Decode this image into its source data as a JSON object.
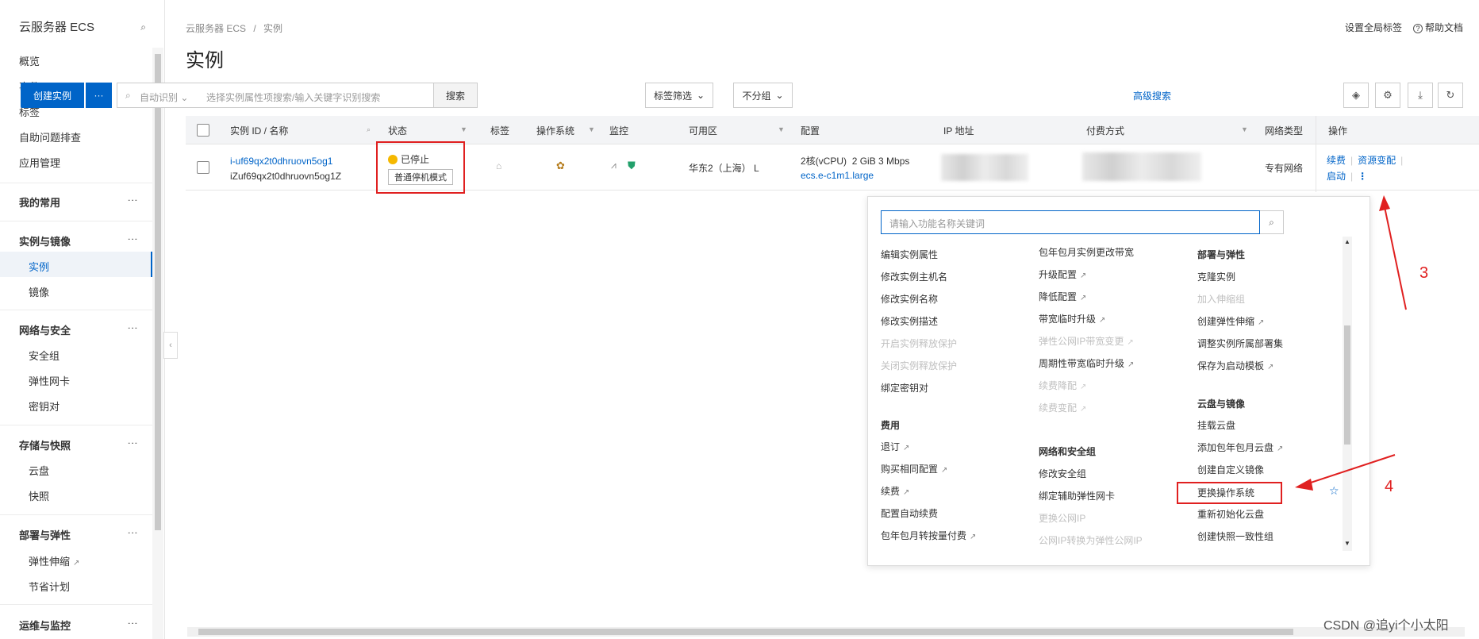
{
  "sidebar": {
    "title": "云服务器 ECS",
    "items": [
      "概览",
      "事件",
      "标签",
      "自助问题排查",
      "应用管理"
    ],
    "groups": [
      {
        "label": "我的常用"
      },
      {
        "label": "实例与镜像",
        "children": [
          "实例",
          "镜像"
        ]
      },
      {
        "label": "网络与安全",
        "children": [
          "安全组",
          "弹性网卡",
          "密钥对"
        ]
      },
      {
        "label": "存储与快照",
        "children": [
          "云盘",
          "快照"
        ]
      },
      {
        "label": "部署与弹性",
        "children": [
          "弹性伸缩",
          "节省计划"
        ]
      },
      {
        "label": "运维与监控"
      }
    ],
    "dots": "⋮",
    "active": "实例"
  },
  "breadcrumb": {
    "root": "云服务器 ECS",
    "sep": "/",
    "current": "实例"
  },
  "page_title": "实例",
  "top_right": {
    "tags": "设置全局标签",
    "help": "帮助文档"
  },
  "toolbar": {
    "create": "创建实例",
    "more": "···",
    "search_mode": "自动识别",
    "search_placeholder": "选择实例属性项搜索/输入关键字识别搜索",
    "search_btn": "搜索",
    "tag_filter": "标签筛选",
    "group": "不分组",
    "advanced": "高级搜索"
  },
  "table": {
    "headers": [
      "实例 ID / 名称",
      "状态",
      "标签",
      "操作系统",
      "监控",
      "可用区",
      "配置",
      "IP 地址",
      "付费方式",
      "网络类型",
      "操作"
    ],
    "row": {
      "id": "i-uf69qx2t0dhruovn5og1",
      "name": "iZuf69qx2t0dhruovn5og1Z",
      "status": "已停止",
      "stop_mode": "普通停机模式",
      "zone": "华东2（上海） L",
      "config_cpu": "2核(vCPU)",
      "config_mem": "2 GiB 3 Mbps",
      "config_type": "ecs.e-c1m1.large",
      "network": "专有网络",
      "op_renew": "续费",
      "op_change": "资源变配",
      "op_start": "启动",
      "op_more": "⋮"
    }
  },
  "panel": {
    "placeholder": "请输入功能名称关键词",
    "col1": [
      {
        "t": "编辑实例属性"
      },
      {
        "t": "修改实例主机名"
      },
      {
        "t": "修改实例名称"
      },
      {
        "t": "修改实例描述"
      },
      {
        "t": "开启实例释放保护",
        "dis": true
      },
      {
        "t": "关闭实例释放保护",
        "dis": true
      },
      {
        "t": "绑定密钥对"
      }
    ],
    "col1_head2": "费用",
    "col1b": [
      {
        "t": "退订",
        "ext": true
      },
      {
        "t": "购买相同配置",
        "ext": true
      },
      {
        "t": "续费",
        "ext": true
      },
      {
        "t": "配置自动续费"
      },
      {
        "t": "包年包月转按量付费",
        "ext": true
      }
    ],
    "col2": [
      {
        "t": "包年包月实例更改带宽"
      },
      {
        "t": "升级配置",
        "ext": true
      },
      {
        "t": "降低配置",
        "ext": true
      },
      {
        "t": "带宽临时升级",
        "ext": true
      },
      {
        "t": "弹性公网IP带宽变更",
        "ext": true,
        "dis": true
      },
      {
        "t": "周期性带宽临时升级",
        "ext": true
      },
      {
        "t": "续费降配",
        "ext": true,
        "dis": true
      },
      {
        "t": "续费变配",
        "ext": true,
        "dis": true
      }
    ],
    "col2_head2": "网络和安全组",
    "col2b": [
      {
        "t": "修改安全组"
      },
      {
        "t": "绑定辅助弹性网卡"
      },
      {
        "t": "更换公网IP",
        "dis": true
      },
      {
        "t": "公网IP转换为弹性公网IP",
        "dis": true
      }
    ],
    "col3_head1": "部署与弹性",
    "col3": [
      {
        "t": "克隆实例"
      },
      {
        "t": "加入伸缩组",
        "dis": true
      },
      {
        "t": "创建弹性伸缩",
        "ext": true
      },
      {
        "t": "调整实例所属部署集"
      },
      {
        "t": "保存为启动模板",
        "ext": true
      }
    ],
    "col3_head2": "云盘与镜像",
    "col3b": [
      {
        "t": "挂载云盘"
      },
      {
        "t": "添加包年包月云盘",
        "ext": true
      },
      {
        "t": "创建自定义镜像"
      },
      {
        "t": "更换操作系统"
      },
      {
        "t": "重新初始化云盘"
      },
      {
        "t": "创建快照一致性组"
      }
    ]
  },
  "annotations": {
    "a3": "3",
    "a4": "4"
  },
  "watermark": "CSDN @追yi个小太阳",
  "colors": {
    "primary": "#0064c8",
    "annotation": "#e02020",
    "warning": "#f5b800"
  }
}
